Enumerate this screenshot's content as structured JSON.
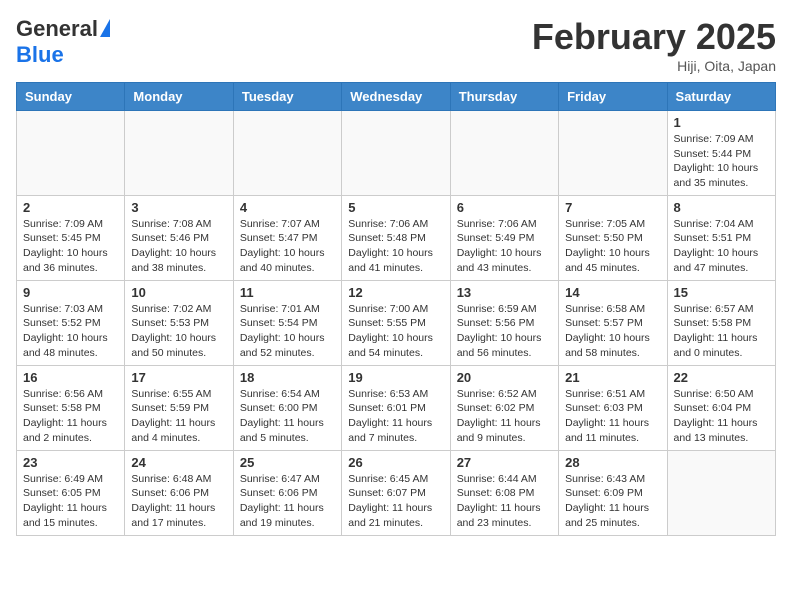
{
  "header": {
    "logo_general": "General",
    "logo_blue": "Blue",
    "month_title": "February 2025",
    "location": "Hiji, Oita, Japan"
  },
  "days_of_week": [
    "Sunday",
    "Monday",
    "Tuesday",
    "Wednesday",
    "Thursday",
    "Friday",
    "Saturday"
  ],
  "weeks": [
    [
      {
        "day": "",
        "info": ""
      },
      {
        "day": "",
        "info": ""
      },
      {
        "day": "",
        "info": ""
      },
      {
        "day": "",
        "info": ""
      },
      {
        "day": "",
        "info": ""
      },
      {
        "day": "",
        "info": ""
      },
      {
        "day": "1",
        "info": "Sunrise: 7:09 AM\nSunset: 5:44 PM\nDaylight: 10 hours\nand 35 minutes."
      }
    ],
    [
      {
        "day": "2",
        "info": "Sunrise: 7:09 AM\nSunset: 5:45 PM\nDaylight: 10 hours\nand 36 minutes."
      },
      {
        "day": "3",
        "info": "Sunrise: 7:08 AM\nSunset: 5:46 PM\nDaylight: 10 hours\nand 38 minutes."
      },
      {
        "day": "4",
        "info": "Sunrise: 7:07 AM\nSunset: 5:47 PM\nDaylight: 10 hours\nand 40 minutes."
      },
      {
        "day": "5",
        "info": "Sunrise: 7:06 AM\nSunset: 5:48 PM\nDaylight: 10 hours\nand 41 minutes."
      },
      {
        "day": "6",
        "info": "Sunrise: 7:06 AM\nSunset: 5:49 PM\nDaylight: 10 hours\nand 43 minutes."
      },
      {
        "day": "7",
        "info": "Sunrise: 7:05 AM\nSunset: 5:50 PM\nDaylight: 10 hours\nand 45 minutes."
      },
      {
        "day": "8",
        "info": "Sunrise: 7:04 AM\nSunset: 5:51 PM\nDaylight: 10 hours\nand 47 minutes."
      }
    ],
    [
      {
        "day": "9",
        "info": "Sunrise: 7:03 AM\nSunset: 5:52 PM\nDaylight: 10 hours\nand 48 minutes."
      },
      {
        "day": "10",
        "info": "Sunrise: 7:02 AM\nSunset: 5:53 PM\nDaylight: 10 hours\nand 50 minutes."
      },
      {
        "day": "11",
        "info": "Sunrise: 7:01 AM\nSunset: 5:54 PM\nDaylight: 10 hours\nand 52 minutes."
      },
      {
        "day": "12",
        "info": "Sunrise: 7:00 AM\nSunset: 5:55 PM\nDaylight: 10 hours\nand 54 minutes."
      },
      {
        "day": "13",
        "info": "Sunrise: 6:59 AM\nSunset: 5:56 PM\nDaylight: 10 hours\nand 56 minutes."
      },
      {
        "day": "14",
        "info": "Sunrise: 6:58 AM\nSunset: 5:57 PM\nDaylight: 10 hours\nand 58 minutes."
      },
      {
        "day": "15",
        "info": "Sunrise: 6:57 AM\nSunset: 5:58 PM\nDaylight: 11 hours\nand 0 minutes."
      }
    ],
    [
      {
        "day": "16",
        "info": "Sunrise: 6:56 AM\nSunset: 5:58 PM\nDaylight: 11 hours\nand 2 minutes."
      },
      {
        "day": "17",
        "info": "Sunrise: 6:55 AM\nSunset: 5:59 PM\nDaylight: 11 hours\nand 4 minutes."
      },
      {
        "day": "18",
        "info": "Sunrise: 6:54 AM\nSunset: 6:00 PM\nDaylight: 11 hours\nand 5 minutes."
      },
      {
        "day": "19",
        "info": "Sunrise: 6:53 AM\nSunset: 6:01 PM\nDaylight: 11 hours\nand 7 minutes."
      },
      {
        "day": "20",
        "info": "Sunrise: 6:52 AM\nSunset: 6:02 PM\nDaylight: 11 hours\nand 9 minutes."
      },
      {
        "day": "21",
        "info": "Sunrise: 6:51 AM\nSunset: 6:03 PM\nDaylight: 11 hours\nand 11 minutes."
      },
      {
        "day": "22",
        "info": "Sunrise: 6:50 AM\nSunset: 6:04 PM\nDaylight: 11 hours\nand 13 minutes."
      }
    ],
    [
      {
        "day": "23",
        "info": "Sunrise: 6:49 AM\nSunset: 6:05 PM\nDaylight: 11 hours\nand 15 minutes."
      },
      {
        "day": "24",
        "info": "Sunrise: 6:48 AM\nSunset: 6:06 PM\nDaylight: 11 hours\nand 17 minutes."
      },
      {
        "day": "25",
        "info": "Sunrise: 6:47 AM\nSunset: 6:06 PM\nDaylight: 11 hours\nand 19 minutes."
      },
      {
        "day": "26",
        "info": "Sunrise: 6:45 AM\nSunset: 6:07 PM\nDaylight: 11 hours\nand 21 minutes."
      },
      {
        "day": "27",
        "info": "Sunrise: 6:44 AM\nSunset: 6:08 PM\nDaylight: 11 hours\nand 23 minutes."
      },
      {
        "day": "28",
        "info": "Sunrise: 6:43 AM\nSunset: 6:09 PM\nDaylight: 11 hours\nand 25 minutes."
      },
      {
        "day": "",
        "info": ""
      }
    ]
  ]
}
